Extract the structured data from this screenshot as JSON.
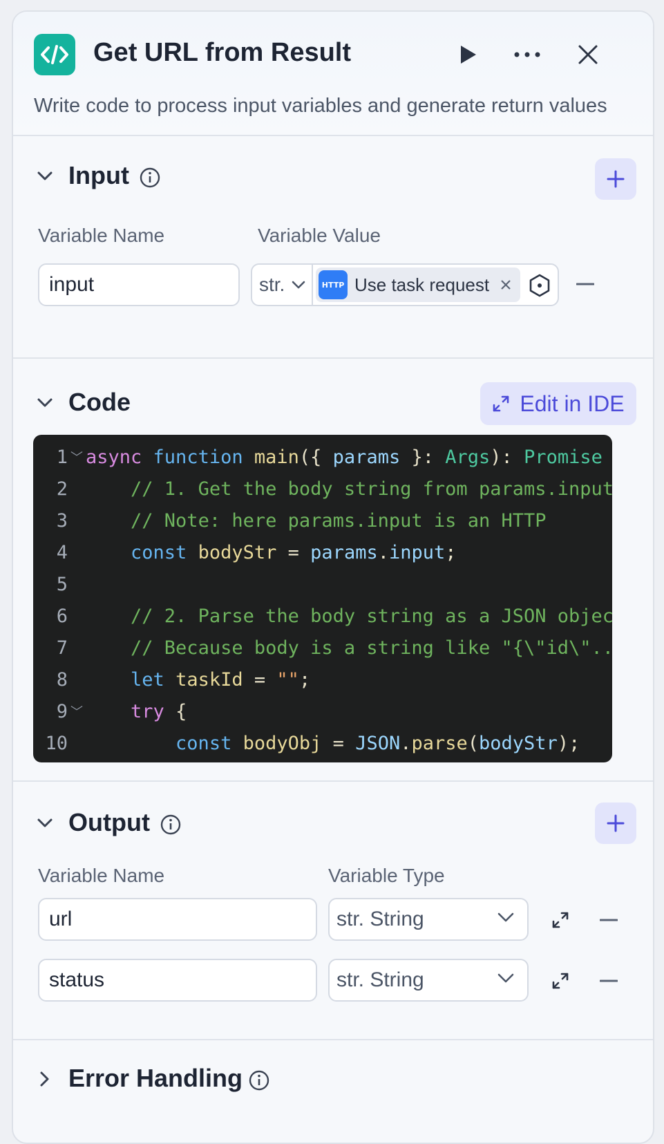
{
  "header": {
    "title": "Get URL from Result",
    "subtitle": "Write code to process input variables and generate return values",
    "logo_icon": "code-icon",
    "actions": [
      "play-icon",
      "more-icon",
      "close-icon"
    ]
  },
  "input": {
    "title": "Input",
    "col_name": "Variable Name",
    "col_value": "Variable Value",
    "rows": [
      {
        "name": "input",
        "type": "str.",
        "ref_badge": "HTTP",
        "ref_label": "Use task request …"
      }
    ]
  },
  "code": {
    "title": "Code",
    "ide_label": "Edit in IDE",
    "lines": [
      "1",
      "2",
      "3",
      "4",
      "5",
      "6",
      "7",
      "8",
      "9",
      "10"
    ]
  },
  "output": {
    "title": "Output",
    "col_name": "Variable Name",
    "col_type": "Variable Type",
    "rows": [
      {
        "name": "url",
        "type": "str. String"
      },
      {
        "name": "status",
        "type": "str. String"
      }
    ]
  },
  "error": {
    "title": "Error Handling"
  },
  "colors": {
    "accent": "#4b4ad9",
    "logo": "#14b39d",
    "http_badge": "#2f7df6",
    "code_bg": "#1e1f1f"
  }
}
